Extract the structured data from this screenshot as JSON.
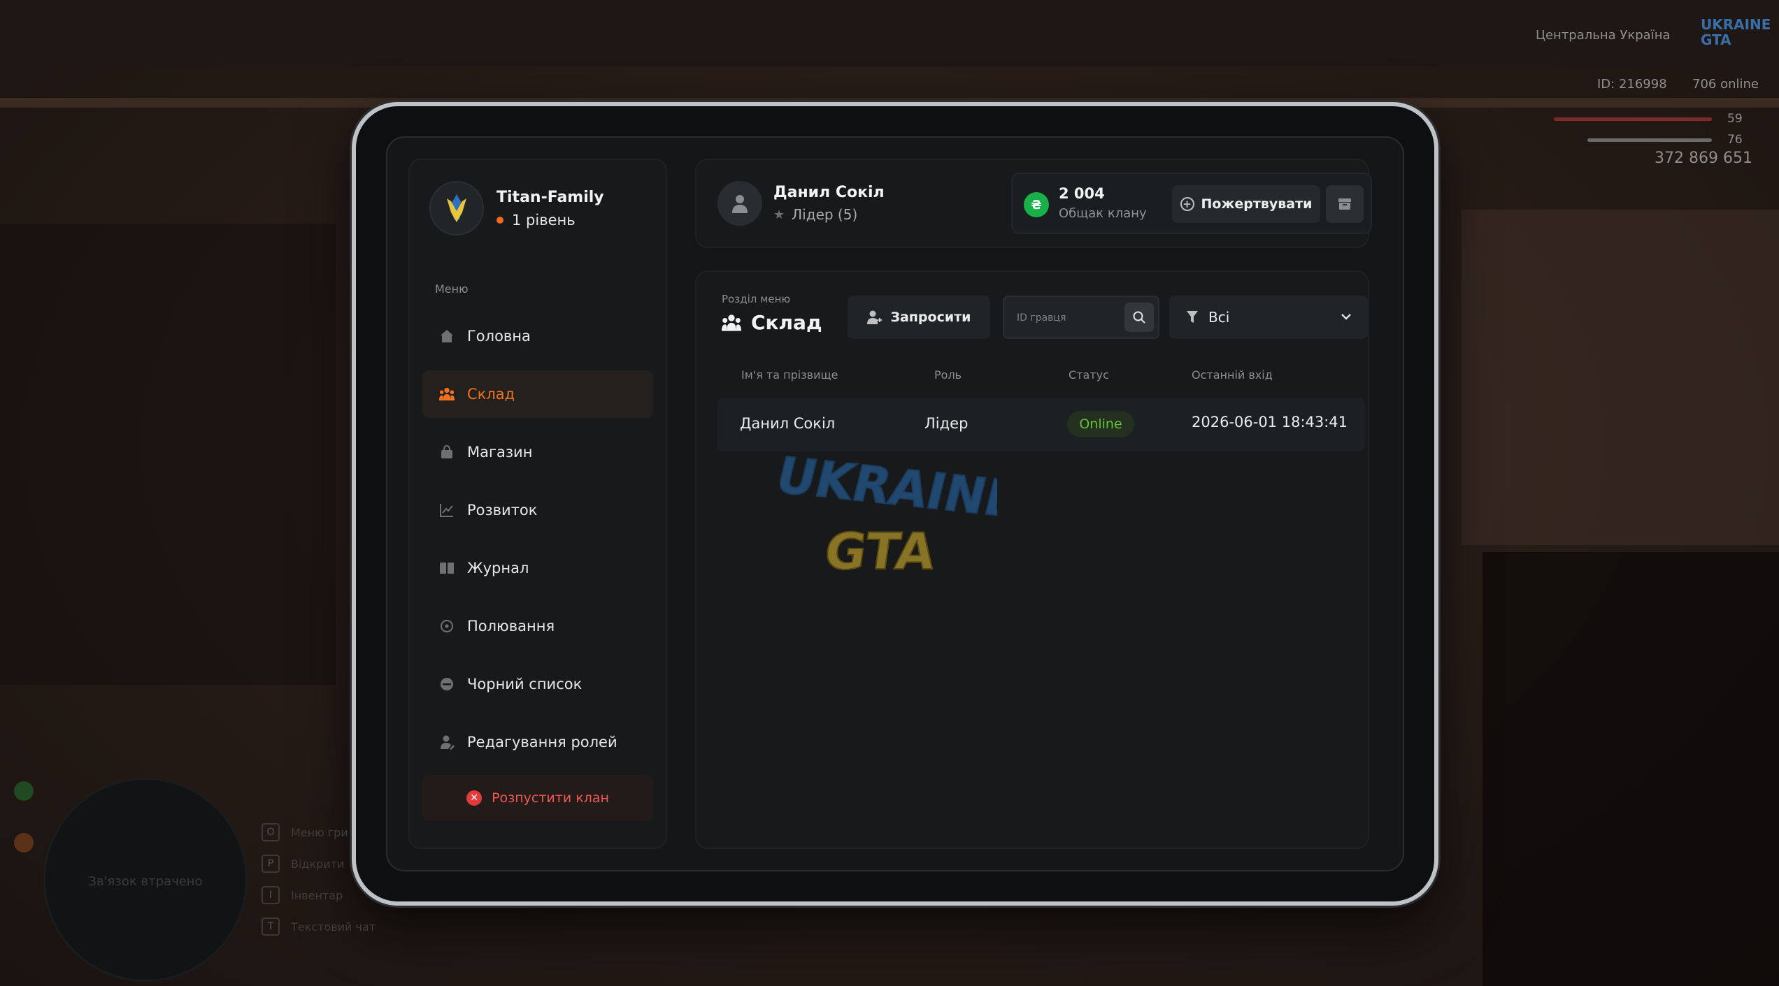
{
  "hud": {
    "region": "Центральна Україна",
    "server_logo": "UKRAINE GTA",
    "player_id": "ID: 216998",
    "online": "706 online",
    "health": "59",
    "armor": "76",
    "money": "372 869 651",
    "health_color": "#d9534f",
    "armor_color": "#9a9a9a"
  },
  "clan": {
    "name": "Titan-Family",
    "level": "1 рівень"
  },
  "sidebar": {
    "menu_caption": "Меню",
    "items": [
      {
        "label": "Головна",
        "icon": "home-icon"
      },
      {
        "label": "Склад",
        "icon": "people-icon",
        "active": true
      },
      {
        "label": "Магазин",
        "icon": "shop-icon"
      },
      {
        "label": "Розвиток",
        "icon": "chart-icon"
      },
      {
        "label": "Журнал",
        "icon": "journal-icon"
      },
      {
        "label": "Полювання",
        "icon": "target-icon"
      },
      {
        "label": "Чорний список",
        "icon": "block-icon"
      },
      {
        "label": "Редагування ролей",
        "icon": "user-edit-icon"
      }
    ],
    "disband_label": "Розпустити клан"
  },
  "user": {
    "name": "Данил Сокіл",
    "role": "Лідер (5)"
  },
  "bank": {
    "amount": "2 004",
    "label": "Общак клану",
    "currency_symbol": "₴",
    "donate_label": "Пожертвувати"
  },
  "section": {
    "caption": "Розділ меню",
    "title": "Склад",
    "invite_label": "Запросити",
    "search_placeholder": "ID гравця",
    "filter_value": "Всі"
  },
  "table": {
    "columns": [
      "Ім'я та прізвище",
      "Роль",
      "Статус",
      "Останній вхід"
    ],
    "rows": [
      {
        "name": "Данил Сокіл",
        "role": "Лідер",
        "status": "Online",
        "last_login": "2026-06-01 18:43:41"
      }
    ]
  },
  "watermark": {
    "line1": "UKRAINE",
    "line2": "GTA"
  },
  "minimap": {
    "text": "Зв'язок втрачено"
  },
  "hotkeys": [
    {
      "key": "O",
      "label": "Меню гри"
    },
    {
      "key": "P",
      "label": "Відкрити"
    },
    {
      "key": "I",
      "label": "Інвентар"
    },
    {
      "key": "T",
      "label": "Текстовий чат"
    }
  ],
  "colors": {
    "accent": "#f0711f",
    "online": "#63c13c",
    "danger": "#e23b3b",
    "money": "#19b04a"
  }
}
